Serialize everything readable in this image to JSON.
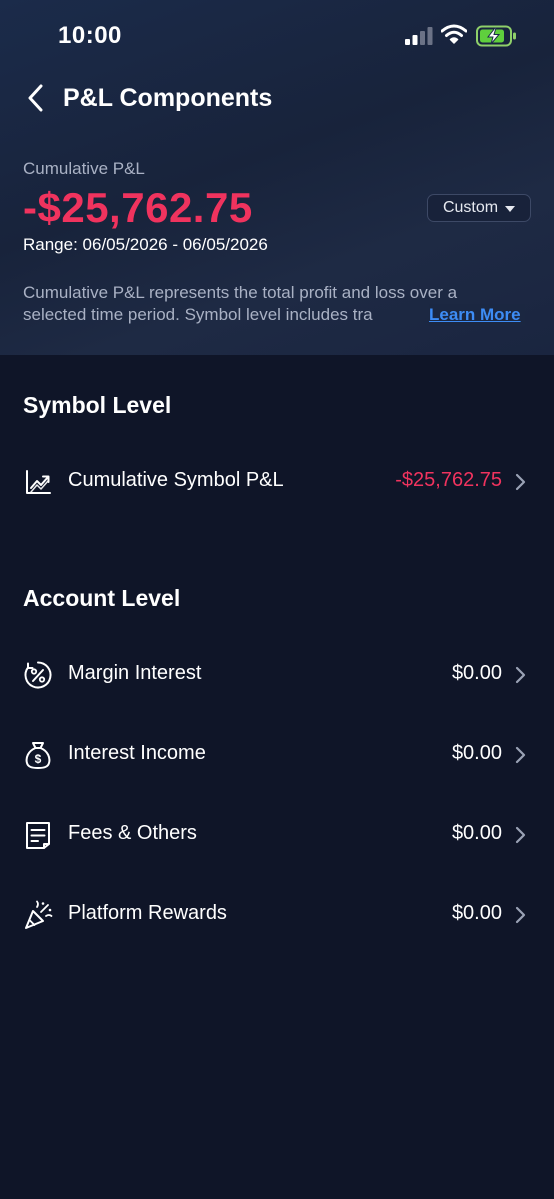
{
  "status_bar": {
    "time": "10:00",
    "icons": [
      "cellular-signal-icon",
      "wifi-icon",
      "battery-charging-icon"
    ]
  },
  "nav": {
    "back_icon": "chevron-left-icon",
    "title": "P&L Components"
  },
  "summary": {
    "label": "Cumulative P&L",
    "value": "-$25,762.75",
    "value_color": "#f0335e",
    "period_button": "Custom",
    "range": "Range: 06/05/2026 - 06/05/2026",
    "description_line1": "Cumulative P&L represents the total profit and loss over a",
    "description_line2": "selected time period. Symbol level includes tra",
    "learn_more": "Learn More",
    "link_color": "#3d8cf5"
  },
  "symbol_section": {
    "title": "Symbol Level",
    "rows": [
      {
        "icon": "trend-chart-icon",
        "label": "Cumulative Symbol P&L",
        "value": "-$25,762.75"
      }
    ]
  },
  "account_section": {
    "title": "Account Level",
    "rows": [
      {
        "icon": "percent-circle-icon",
        "label": "Margin Interest",
        "value": "$0.00"
      },
      {
        "icon": "money-bag-icon",
        "label": "Interest Income",
        "value": "$0.00"
      },
      {
        "icon": "receipt-icon",
        "label": "Fees & Others",
        "value": "$0.00"
      },
      {
        "icon": "party-popper-icon",
        "label": "Platform Rewards",
        "value": "$0.00"
      }
    ]
  }
}
